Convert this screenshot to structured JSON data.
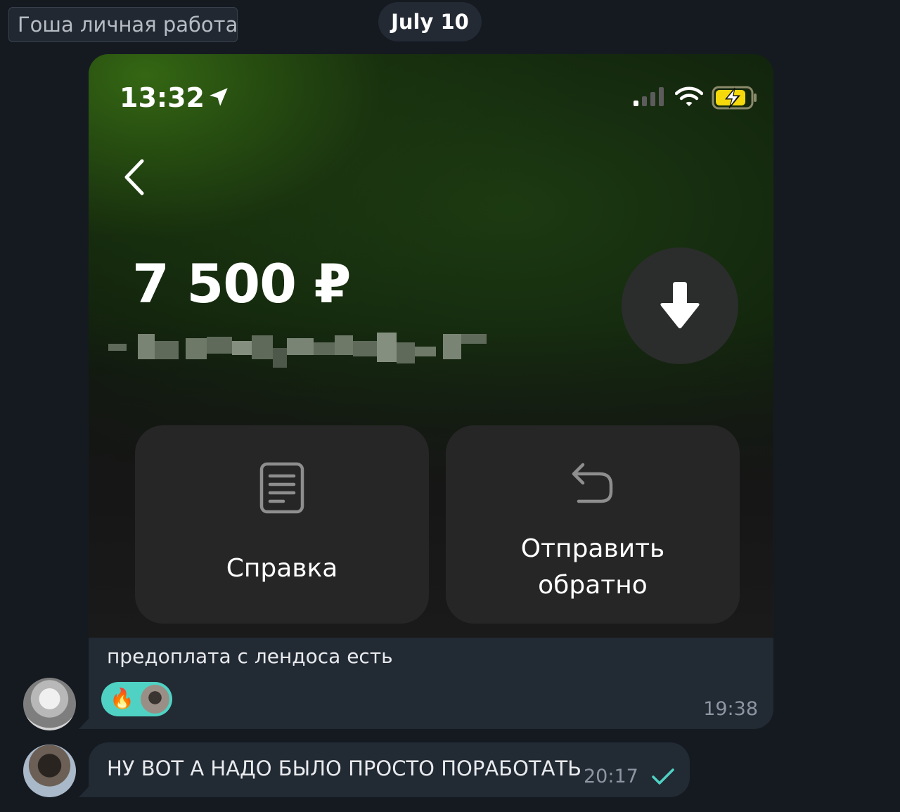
{
  "header": {
    "chat_name": "Гоша личная работа",
    "date_label": "July 10"
  },
  "message_1": {
    "screenshot": {
      "status_time": "13:32",
      "amount": "7 500 ₽",
      "actions": [
        {
          "label": "Справка",
          "icon": "document-icon"
        },
        {
          "label_line1": "Отправить",
          "label_line2": "обратно",
          "icon": "return-arrow-icon"
        }
      ],
      "battery_color": "#f5d90a"
    },
    "caption": "предоплата с лендоса есть",
    "reaction_emoji": "🔥",
    "reaction_color": "#4fd2c3",
    "time": "19:38"
  },
  "message_2": {
    "text": "НУ ВОТ А НАДО БЫЛО ПРОСТО ПОРАБОТАТЬ",
    "time": "20:17",
    "status": "sent-check-icon"
  }
}
